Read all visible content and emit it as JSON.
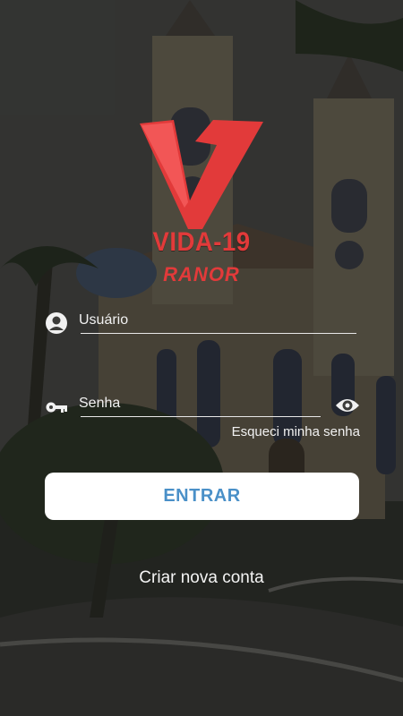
{
  "brand": {
    "title": "VIDA-19",
    "subtitle": "RANOR",
    "color": "#e23a3a"
  },
  "login": {
    "username_label": "Usuário",
    "password_label": "Senha",
    "forgot_password": "Esqueci minha senha",
    "enter_button": "ENTRAR",
    "create_account": "Criar nova conta"
  },
  "colors": {
    "accent": "#4a90c8",
    "overlay": "#141414"
  },
  "icons": {
    "username": "user-circle-icon",
    "password": "key-icon",
    "toggle_visibility": "eye-icon"
  }
}
